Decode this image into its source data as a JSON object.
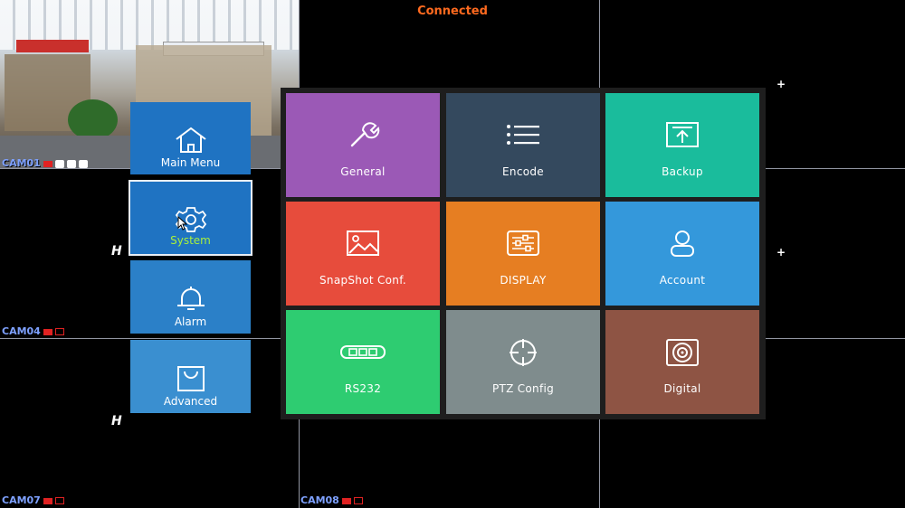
{
  "status": "Connected",
  "cameras": [
    {
      "label": "CAM01"
    },
    {
      "label": "CAM04"
    },
    {
      "label": "CAM07"
    },
    {
      "label": "CAM08"
    }
  ],
  "side_menu": {
    "items": [
      {
        "label": "Main Menu",
        "icon": "home-icon",
        "color": "#1f73c2"
      },
      {
        "label": "System",
        "icon": "gear-icon",
        "color": "#1f73c2",
        "selected": true,
        "label_color": "#a8f03c"
      },
      {
        "label": "Alarm",
        "icon": "bell-icon",
        "color": "#2b80c8"
      },
      {
        "label": "Advanced",
        "icon": "bag-icon",
        "color": "#3a8fd0"
      }
    ]
  },
  "system_menu": {
    "tiles": [
      {
        "label": "General",
        "icon": "wrench-icon",
        "color": "#9b59b6"
      },
      {
        "label": "Encode",
        "icon": "list-icon",
        "color": "#34495e"
      },
      {
        "label": "Backup",
        "icon": "upload-icon",
        "color": "#1abc9c"
      },
      {
        "label": "SnapShot Conf.",
        "icon": "image-icon",
        "color": "#e74c3c"
      },
      {
        "label": "DISPLAY",
        "icon": "sliders-icon",
        "color": "#e67e22"
      },
      {
        "label": "Account",
        "icon": "user-icon",
        "color": "#3498db"
      },
      {
        "label": "RS232",
        "icon": "serial-port-icon",
        "color": "#2ecc71"
      },
      {
        "label": "PTZ Config",
        "icon": "crosshair-icon",
        "color": "#7f8c8d"
      },
      {
        "label": "Digital",
        "icon": "disk-icon",
        "color": "#8e5444"
      }
    ]
  }
}
